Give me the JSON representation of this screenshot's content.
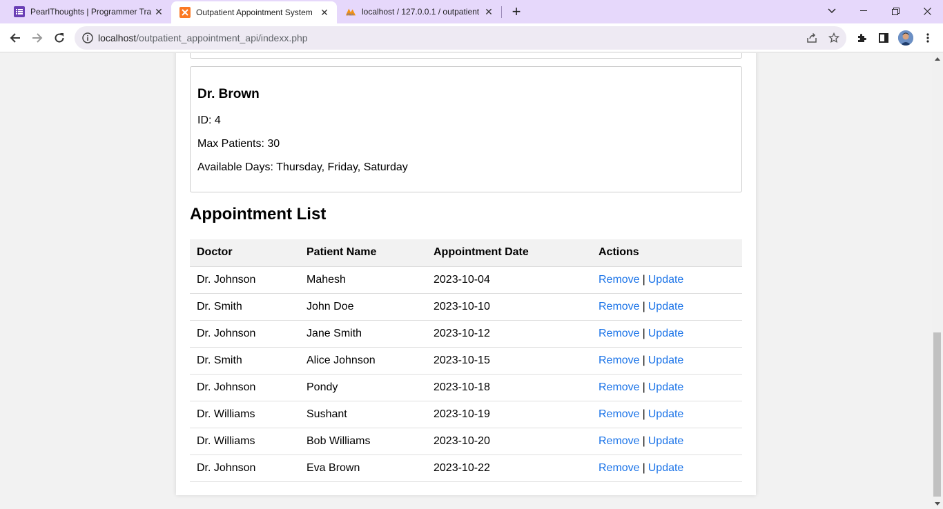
{
  "browser": {
    "tabs": [
      {
        "title": "PearlThoughts | Programmer Tra",
        "icon": "list-icon",
        "icon_color": "#6a3fb5",
        "active": false
      },
      {
        "title": "Outpatient Appointment System",
        "icon": "xampp-icon",
        "icon_color": "#fb7a24",
        "active": true
      },
      {
        "title": "localhost / 127.0.0.1 / outpatient",
        "icon": "phpmyadmin-icon",
        "icon_color": "#f29111",
        "active": false
      }
    ],
    "url_host": "localhost",
    "url_path": "/outpatient_appointment_api/indexx.php"
  },
  "doctor_card": {
    "name": "Dr. Brown",
    "id_line": "ID: 4",
    "max_patients_line": "Max Patients: 30",
    "available_days_line": "Available Days: Thursday, Friday, Saturday"
  },
  "appointments": {
    "title": "Appointment List",
    "columns": [
      "Doctor",
      "Patient Name",
      "Appointment Date",
      "Actions"
    ],
    "remove_label": "Remove",
    "separator": "|",
    "update_label": "Update",
    "rows": [
      {
        "doctor": "Dr. Johnson",
        "patient": "Mahesh",
        "date": "2023-10-04"
      },
      {
        "doctor": "Dr. Smith",
        "patient": "John Doe",
        "date": "2023-10-10"
      },
      {
        "doctor": "Dr. Johnson",
        "patient": "Jane Smith",
        "date": "2023-10-12"
      },
      {
        "doctor": "Dr. Smith",
        "patient": "Alice Johnson",
        "date": "2023-10-15"
      },
      {
        "doctor": "Dr. Johnson",
        "patient": "Pondy",
        "date": "2023-10-18"
      },
      {
        "doctor": "Dr. Williams",
        "patient": "Sushant",
        "date": "2023-10-19"
      },
      {
        "doctor": "Dr. Williams",
        "patient": "Bob Williams",
        "date": "2023-10-20"
      },
      {
        "doctor": "Dr. Johnson",
        "patient": "Eva Brown",
        "date": "2023-10-22"
      }
    ]
  },
  "colors": {
    "link": "#1a73e8",
    "tabbar": "#e6d8fb",
    "header_row": "#f2f2f2"
  }
}
